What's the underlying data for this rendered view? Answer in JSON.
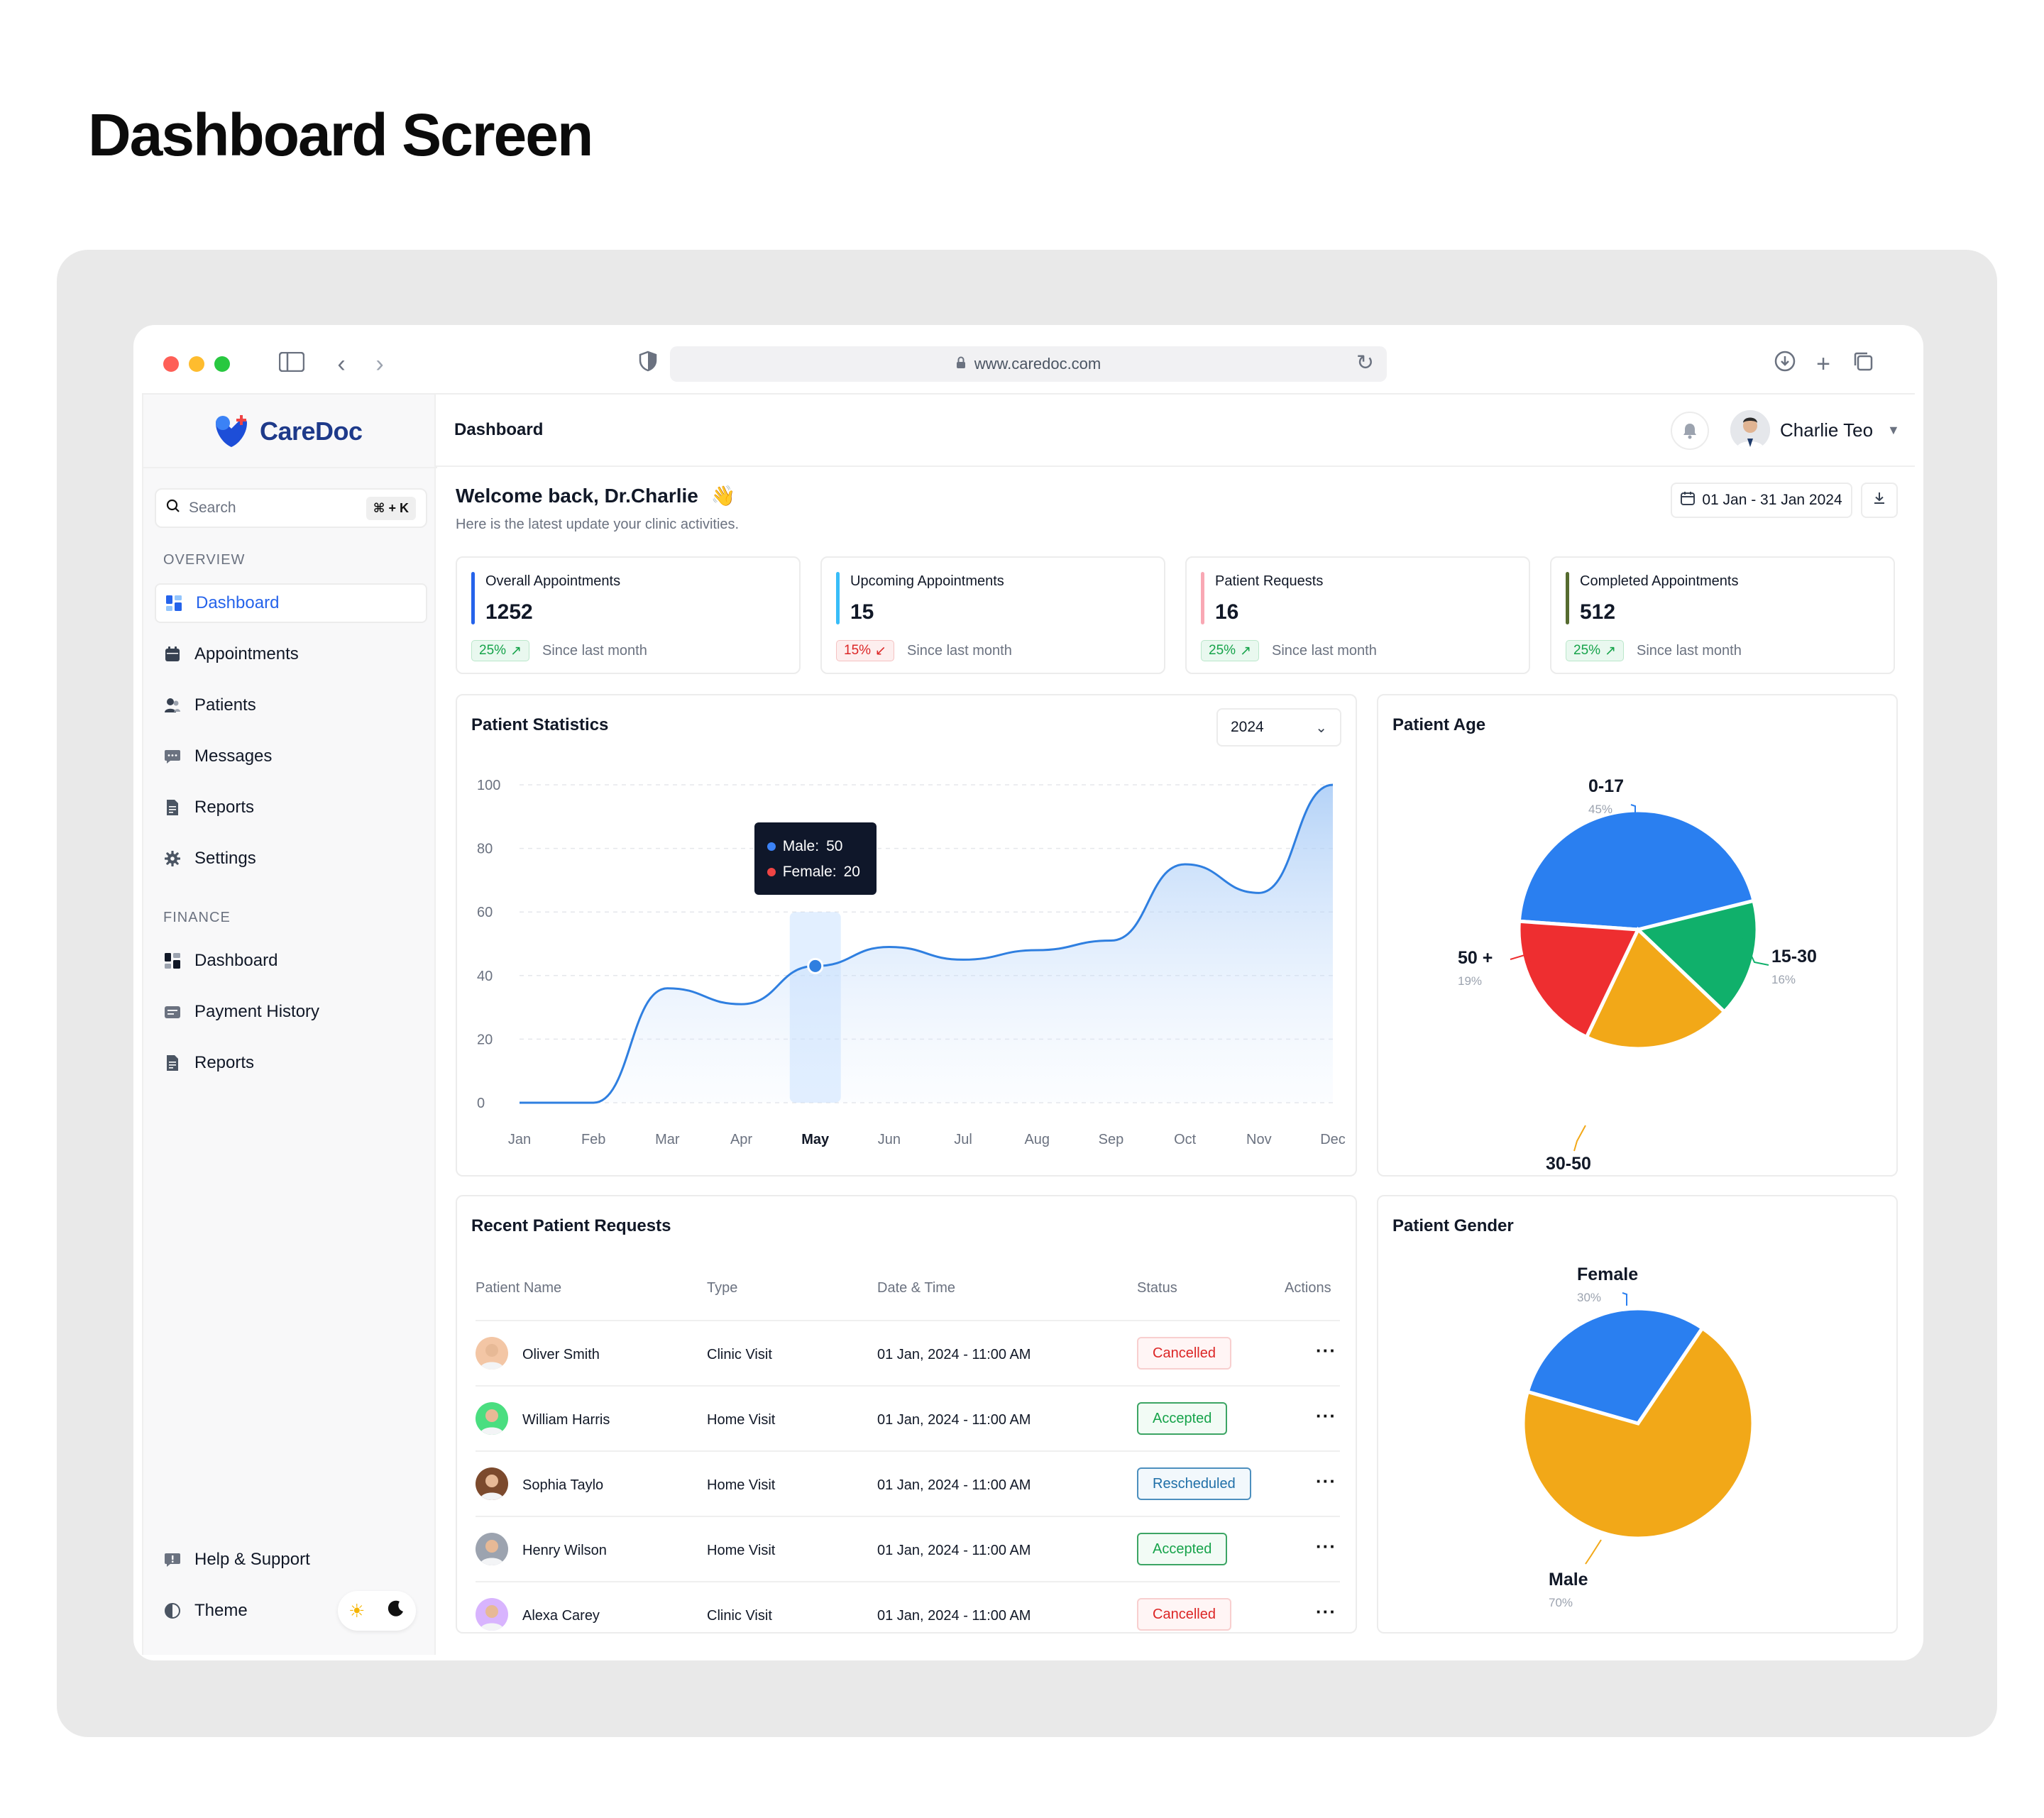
{
  "page": {
    "title": "Dashboard Screen"
  },
  "browser": {
    "url": "www.caredoc.com"
  },
  "brand": {
    "name": "CareDoc"
  },
  "search": {
    "placeholder": "Search",
    "shortcut": "⌘ + K"
  },
  "sidebar": {
    "overview_label": "OVERVIEW",
    "overview_items": [
      {
        "label": "Dashboard",
        "icon": "grid-icon"
      },
      {
        "label": "Appointments",
        "icon": "calendar-icon"
      },
      {
        "label": "Patients",
        "icon": "users-icon"
      },
      {
        "label": "Messages",
        "icon": "chat-icon"
      },
      {
        "label": "Reports",
        "icon": "document-icon"
      },
      {
        "label": "Settings",
        "icon": "gear-icon"
      }
    ],
    "finance_label": "FINANCE",
    "finance_items": [
      {
        "label": "Dashboard",
        "icon": "grid-icon"
      },
      {
        "label": "Payment History",
        "icon": "wallet-icon"
      },
      {
        "label": "Reports",
        "icon": "document-icon"
      }
    ],
    "help_label": "Help & Support",
    "theme_label": "Theme"
  },
  "header": {
    "title": "Dashboard",
    "user_name": "Charlie Teo"
  },
  "welcome": {
    "title": "Welcome back, Dr.Charlie",
    "emoji": "👋",
    "subtitle": "Here is the latest update your clinic activities.",
    "date_range": "01 Jan - 31 Jan 2024"
  },
  "stats": [
    {
      "label": "Overall Appointments",
      "value": "1252",
      "change": "25%",
      "trend": "up",
      "since": "Since last month",
      "color": "#2563eb"
    },
    {
      "label": "Upcoming Appointments",
      "value": "15",
      "change": "15%",
      "trend": "down",
      "since": "Since last month",
      "color": "#38bdf8"
    },
    {
      "label": "Patient Requests",
      "value": "16",
      "change": "25%",
      "trend": "up",
      "since": "Since last month",
      "color": "#f9a8b4"
    },
    {
      "label": "Completed Appointments",
      "value": "512",
      "change": "25%",
      "trend": "up",
      "since": "Since last month",
      "color": "#556b2f"
    }
  ],
  "patient_stats": {
    "title": "Patient Statistics",
    "year": "2024",
    "tooltip": {
      "male_label": "Male:",
      "male_value": "50",
      "female_label": "Female:",
      "female_value": "20"
    }
  },
  "patient_age": {
    "title": "Patient Age"
  },
  "patient_gender": {
    "title": "Patient Gender"
  },
  "requests": {
    "title": "Recent Patient Requests",
    "columns": [
      "Patient Name",
      "Type",
      "Date & Time",
      "Status",
      "Actions"
    ],
    "rows": [
      {
        "name": "Oliver Smith",
        "type": "Clinic Visit",
        "datetime": "01 Jan, 2024 - 11:00 AM",
        "status": "Cancelled",
        "avatar_color": "#f3c6a5"
      },
      {
        "name": "William Harris",
        "type": "Home Visit",
        "datetime": "01 Jan, 2024 - 11:00 AM",
        "status": "Accepted",
        "avatar_color": "#4ade80"
      },
      {
        "name": "Sophia Taylo",
        "type": "Home Visit",
        "datetime": "01 Jan, 2024 - 11:00 AM",
        "status": "Rescheduled",
        "avatar_color": "#7c4a2d"
      },
      {
        "name": "Henry Wilson",
        "type": "Home Visit",
        "datetime": "01 Jan, 2024 - 11:00 AM",
        "status": "Accepted",
        "avatar_color": "#9ca3af"
      },
      {
        "name": "Alexa Carey",
        "type": "Clinic Visit",
        "datetime": "01 Jan, 2024 - 11:00 AM",
        "status": "Cancelled",
        "avatar_color": "#d8b4fe"
      }
    ]
  },
  "chart_data": [
    {
      "type": "area",
      "title": "Patient Statistics",
      "categories": [
        "Jan",
        "Feb",
        "Mar",
        "Apr",
        "May",
        "Jun",
        "Jul",
        "Aug",
        "Sep",
        "Oct",
        "Nov",
        "Dec"
      ],
      "highlight_category": "May",
      "series": [
        {
          "values": [
            0,
            0,
            36,
            31,
            43,
            49,
            45,
            48,
            51,
            75,
            66,
            100
          ]
        }
      ],
      "yticks": [
        0,
        20,
        40,
        60,
        80,
        100
      ],
      "ylim": [
        0,
        100
      ],
      "grid": true,
      "color": "#2f7fe0"
    },
    {
      "type": "pie",
      "title": "Patient Age",
      "slices": [
        {
          "label": "0-17",
          "value": 45,
          "pct": "45%",
          "color": "#2a7ff0"
        },
        {
          "label": "15-30",
          "value": 16,
          "pct": "16%",
          "color": "#10b06b"
        },
        {
          "label": "30-50",
          "value": 20,
          "pct": "20%",
          "color": "#f2a818"
        },
        {
          "label": "50 +",
          "value": 19,
          "pct": "19%",
          "color": "#ee2e30"
        }
      ]
    },
    {
      "type": "pie",
      "title": "Patient Gender",
      "slices": [
        {
          "label": "Female",
          "value": 30,
          "pct": "30%",
          "color": "#2a7ff0"
        },
        {
          "label": "Male",
          "value": 70,
          "pct": "70%",
          "color": "#f2a818"
        }
      ]
    }
  ]
}
